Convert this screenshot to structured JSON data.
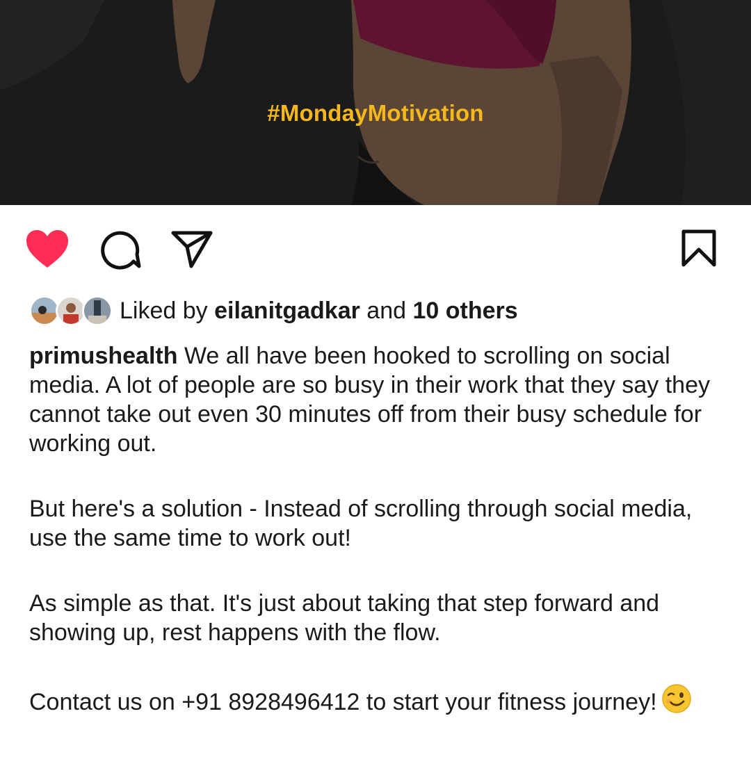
{
  "post": {
    "hashtag": "#MondayMotivation"
  },
  "actions": {
    "like_icon": "heart-filled-icon",
    "comment_icon": "comment-icon",
    "share_icon": "paper-plane-icon",
    "save_icon": "bookmark-icon",
    "like_color": "#ff2d55"
  },
  "likes": {
    "prefix": "Liked by",
    "user": "eilanitgadkar",
    "connector": "and",
    "others": "10 others"
  },
  "caption": {
    "username": "primushealth",
    "p1": "We all have been hooked to scrolling on social media. A lot of people are so busy in their work that they say they cannot take out even 30 minutes off from their busy schedule for working out.",
    "p2": "But here's a solution - Instead of scrolling through social media, use the same time to work out!",
    "p3": "As simple as that. It's just about taking that step forward and showing up, rest happens with the flow.",
    "p4": "Contact us on +91 8928496412 to start your fitness journey!",
    "emoji": "winking-face-emoji"
  },
  "colors": {
    "image_background": "#1b1b1b",
    "hashtag": "#f5b81c",
    "text": "#1a1a1a"
  }
}
